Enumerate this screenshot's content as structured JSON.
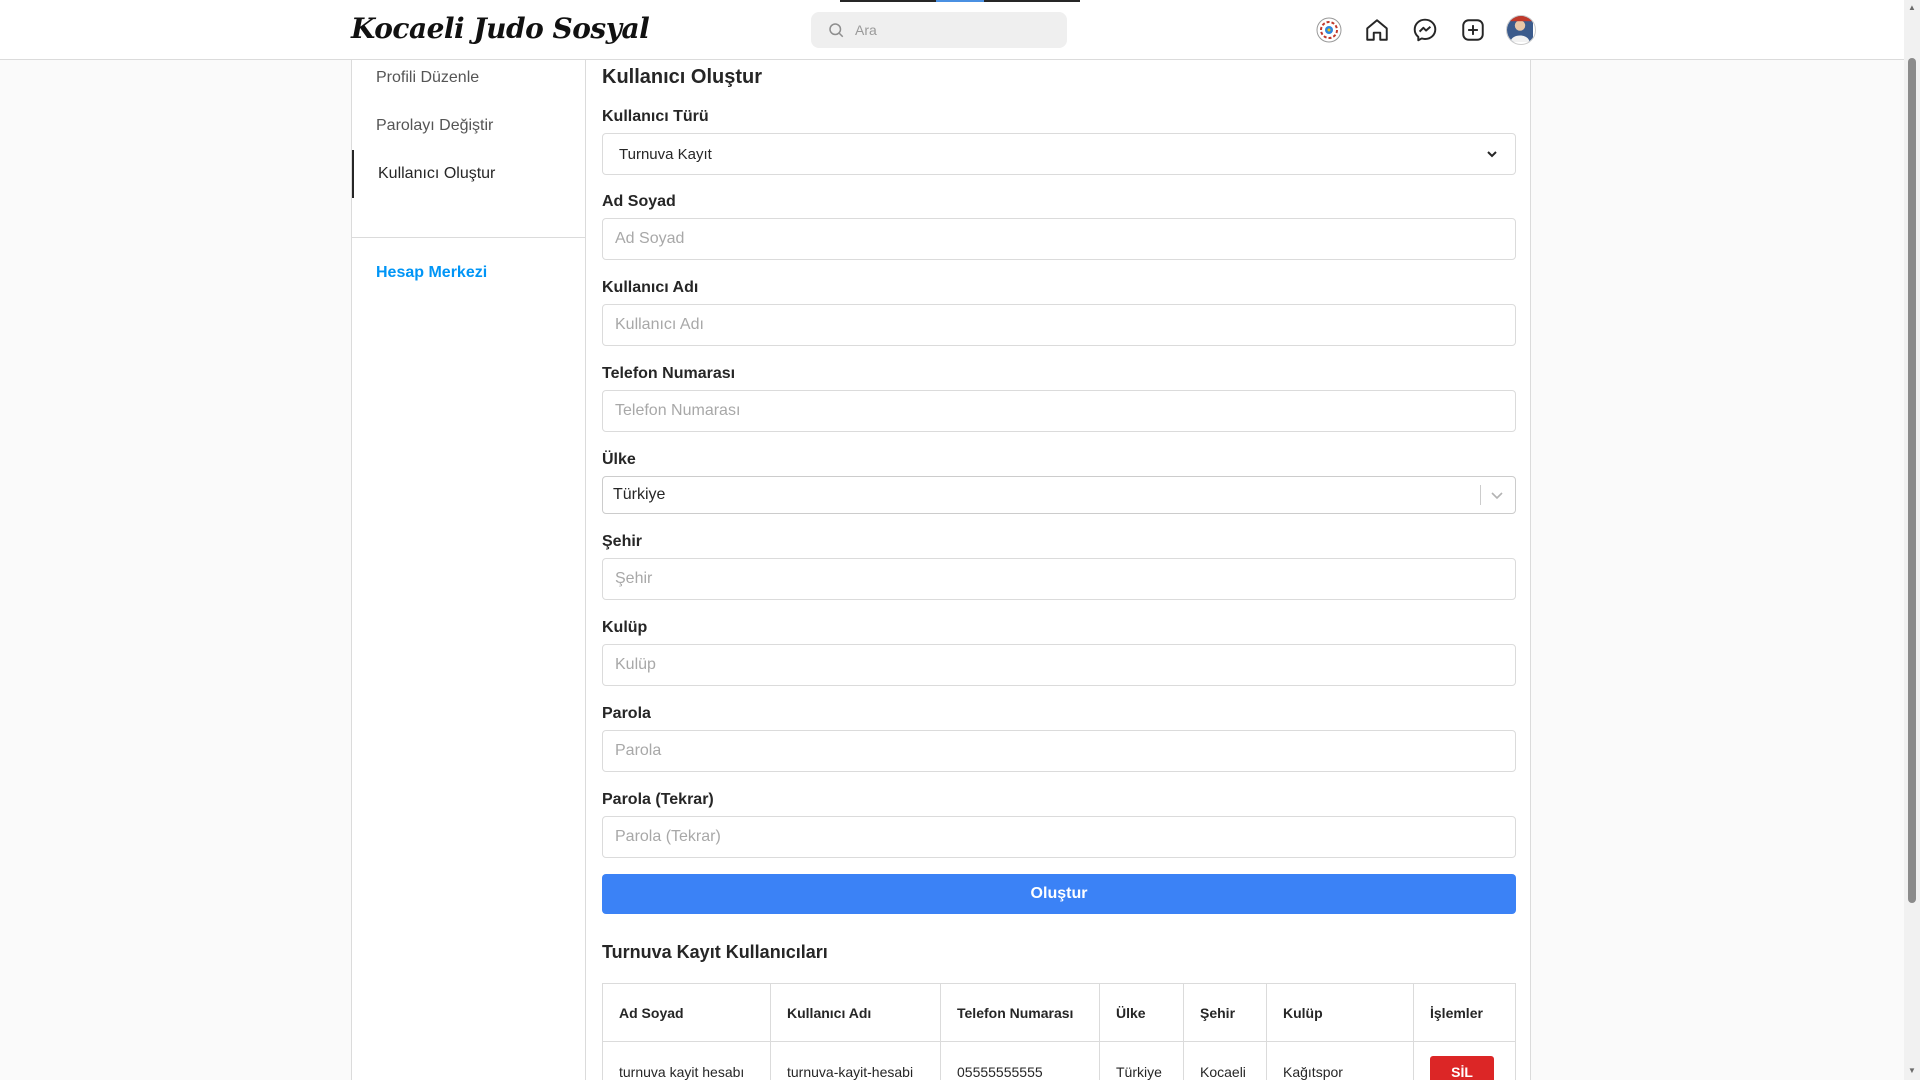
{
  "header": {
    "logo": "Kocaeli Judo Sosyal",
    "search_placeholder": "Ara"
  },
  "sidebar": {
    "items": [
      {
        "label": "Profili Düzenle"
      },
      {
        "label": "Parolayı Değiştir"
      },
      {
        "label": "Kullanıcı Oluştur",
        "active": true
      }
    ],
    "account_center": "Hesap Merkezi"
  },
  "form": {
    "title": "Kullanıcı Oluştur",
    "user_type": {
      "label": "Kullanıcı Türü",
      "value": "Turnuva Kayıt"
    },
    "full_name": {
      "label": "Ad Soyad",
      "placeholder": "Ad Soyad"
    },
    "username": {
      "label": "Kullanıcı Adı",
      "placeholder": "Kullanıcı Adı"
    },
    "phone": {
      "label": "Telefon Numarası",
      "placeholder": "Telefon Numarası"
    },
    "country": {
      "label": "Ülke",
      "value": "Türkiye"
    },
    "city": {
      "label": "Şehir",
      "placeholder": "Şehir"
    },
    "club": {
      "label": "Kulüp",
      "placeholder": "Kulüp"
    },
    "password": {
      "label": "Parola",
      "placeholder": "Parola"
    },
    "password_repeat": {
      "label": "Parola (Tekrar)",
      "placeholder": "Parola (Tekrar)"
    },
    "submit_label": "Oluştur"
  },
  "users_table": {
    "title": "Turnuva Kayıt Kullanıcıları",
    "headers": [
      "Ad Soyad",
      "Kullanıcı Adı",
      "Telefon Numarası",
      "Ülke",
      "Şehir",
      "Kulüp",
      "İşlemler"
    ],
    "rows": [
      {
        "full_name": "turnuva kayit hesabı",
        "username": "turnuva-kayit-hesabi",
        "phone": "05555555555",
        "country": "Türkiye",
        "city": "Kocaeli",
        "club": "Kağıtspor",
        "delete_label": "SİL"
      }
    ]
  },
  "colors": {
    "primary": "#3b82f6",
    "danger": "#dc2626",
    "link": "#0095f6"
  }
}
